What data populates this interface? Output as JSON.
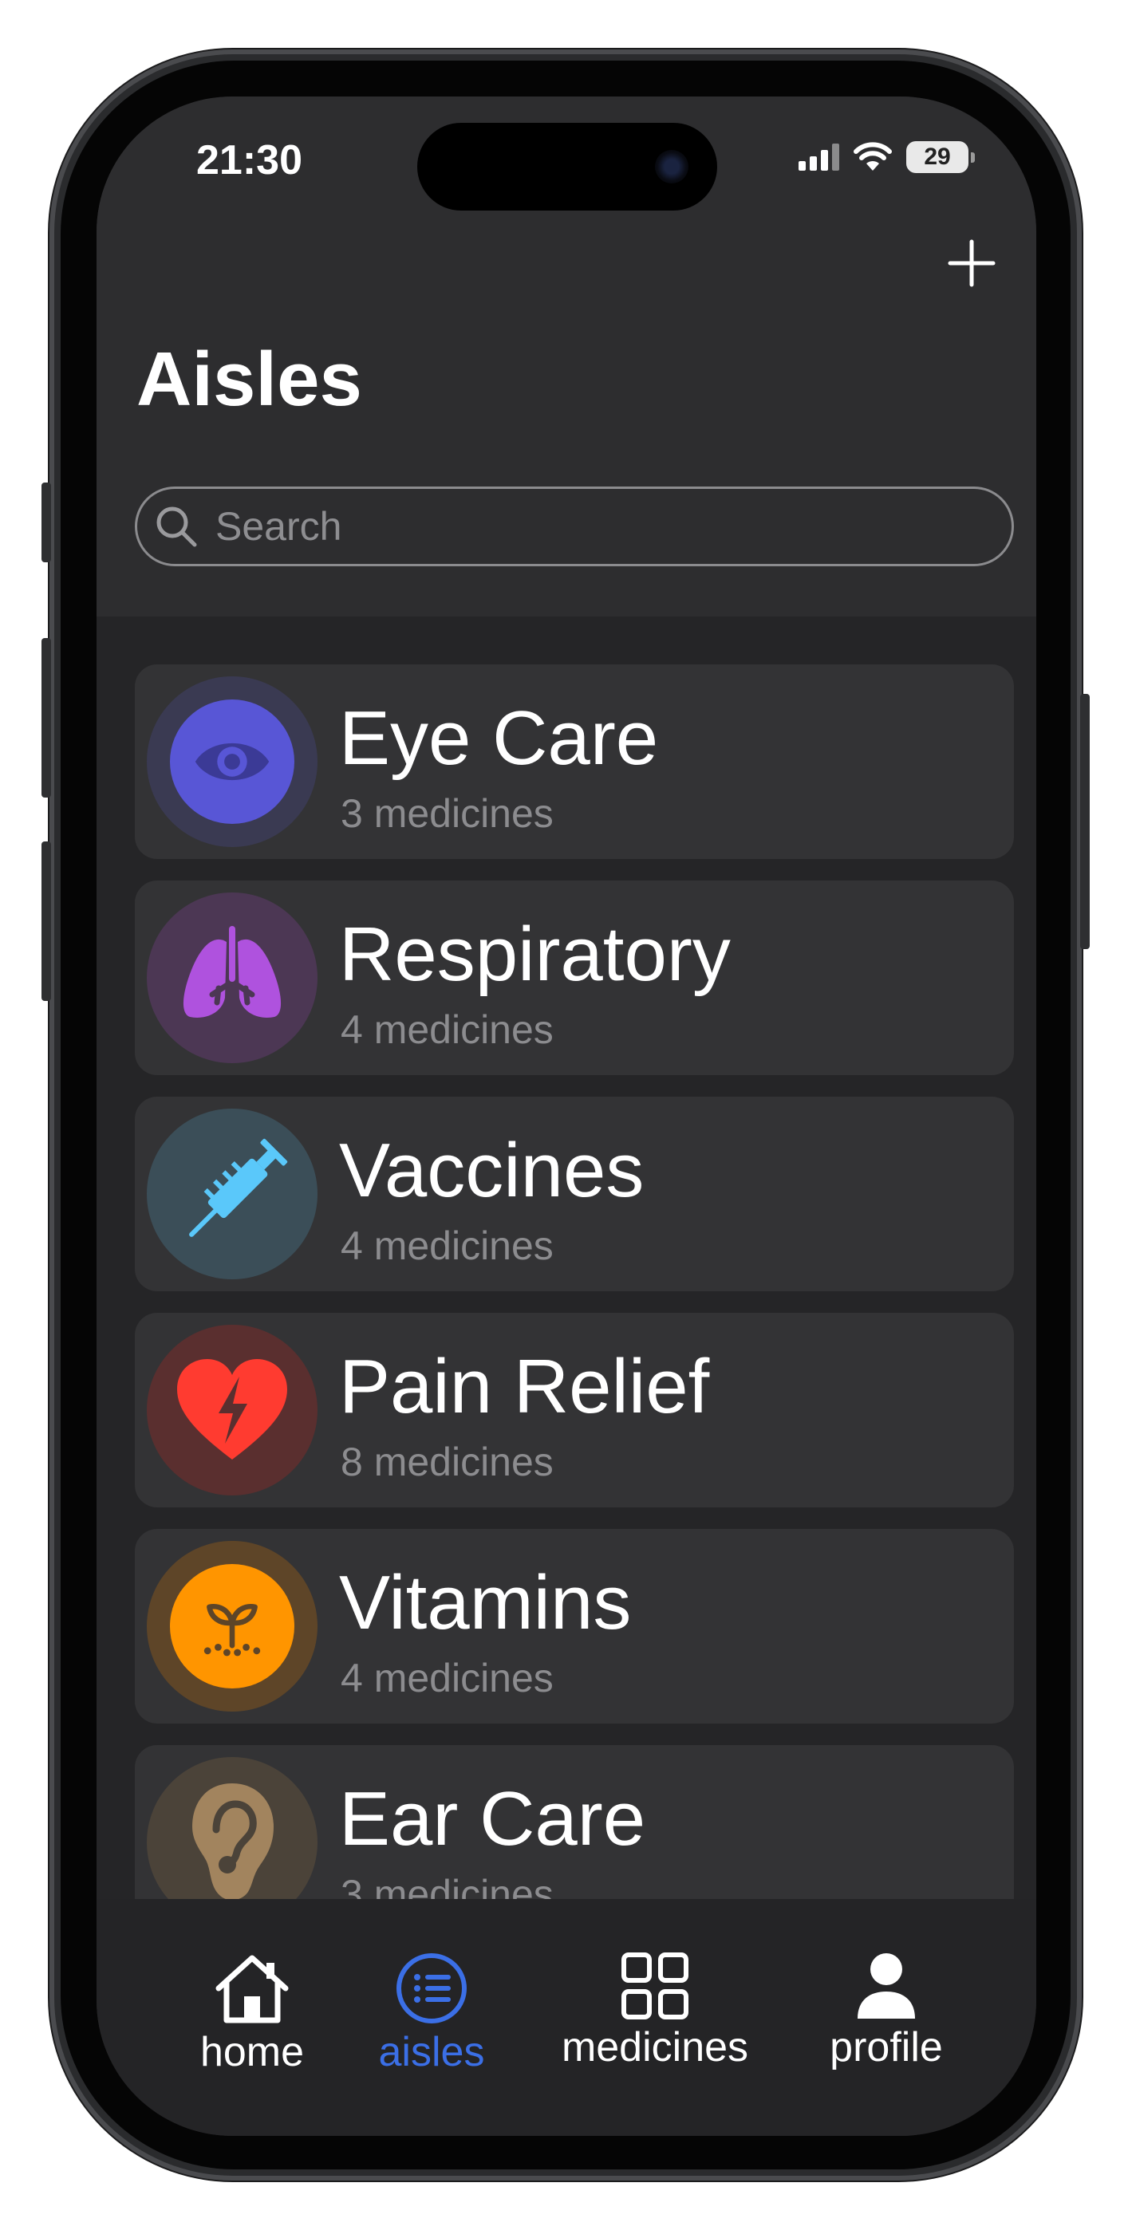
{
  "status_bar": {
    "time": "21:30",
    "battery": "29"
  },
  "header": {
    "title": "Aisles",
    "add_label": "+"
  },
  "search": {
    "placeholder": "Search",
    "value": ""
  },
  "aisles": [
    {
      "name": "Eye Care",
      "count": "3 medicines",
      "icon": "eye-icon",
      "color": "#5856d6"
    },
    {
      "name": "Respiratory",
      "count": "4 medicines",
      "icon": "lungs-icon",
      "color": "#af52de"
    },
    {
      "name": "Vaccines",
      "count": "4 medicines",
      "icon": "syringe-icon",
      "color": "#5ac8fa"
    },
    {
      "name": "Pain Relief",
      "count": "8 medicines",
      "icon": "heart-bolt-icon",
      "color": "#ff3b30"
    },
    {
      "name": "Vitamins",
      "count": "4 medicines",
      "icon": "sprout-icon",
      "color": "#ff9500"
    },
    {
      "name": "Ear Care",
      "count": "3 medicines",
      "icon": "ear-icon",
      "color": "#a2845e"
    }
  ],
  "tabbar": {
    "active": "aisles",
    "accent": "#3b6fe6",
    "items": [
      {
        "label": "home",
        "icon": "house-icon"
      },
      {
        "label": "aisles",
        "icon": "list-icon"
      },
      {
        "label": "medicines",
        "icon": "grid-icon"
      },
      {
        "label": "profile",
        "icon": "person-icon"
      }
    ]
  }
}
